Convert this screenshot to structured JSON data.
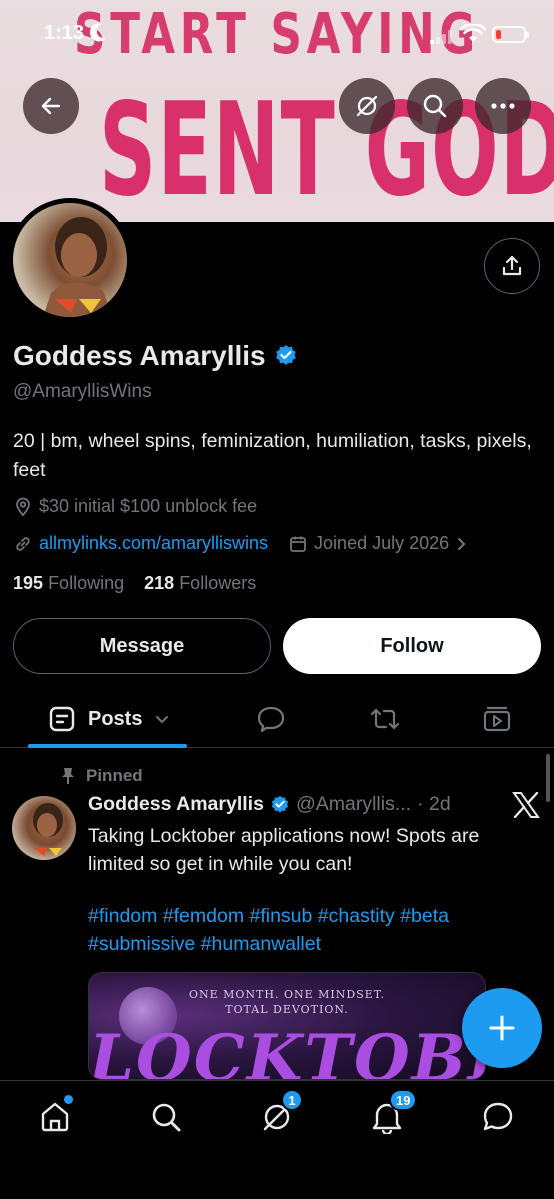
{
  "status_bar": {
    "time": "1:13"
  },
  "banner": {
    "line1": "START SAYING",
    "line2": "SENT GODDESS"
  },
  "profile": {
    "name": "Goddess Amaryllis",
    "handle": "@AmaryllisWins",
    "bio": "20 | bm, wheel spins, feminization, humiliation, tasks, pixels, feet",
    "location": "$30 initial $100 unblock fee",
    "website": "allmylinks.com/amarylliswins",
    "joined": "Joined July 2026",
    "following_count": "195",
    "following_label": "Following",
    "followers_count": "218",
    "followers_label": "Followers"
  },
  "actions": {
    "message_label": "Message",
    "follow_label": "Follow"
  },
  "tabs": {
    "posts_label": "Posts"
  },
  "post": {
    "pinned_label": "Pinned",
    "author_name": "Goddess Amaryllis",
    "author_handle": "@Amaryllis...",
    "time": "· 2d",
    "text": "Taking Locktober applications now! Spots are limited so get in while you can!",
    "hashtags": "#findom #femdom #finsub #chastity #beta #submissive #humanwallet",
    "media": {
      "tagline1": "ONE MONTH. ONE MINDSET.",
      "tagline2": "TOTAL DEVOTION.",
      "title": "LOCKTOBER"
    }
  },
  "bottom_nav": {
    "messages_badge": "1",
    "notifications_badge": "19"
  },
  "colors": {
    "accent": "#1d9bf0",
    "background": "#000000",
    "muted": "#71767b"
  }
}
